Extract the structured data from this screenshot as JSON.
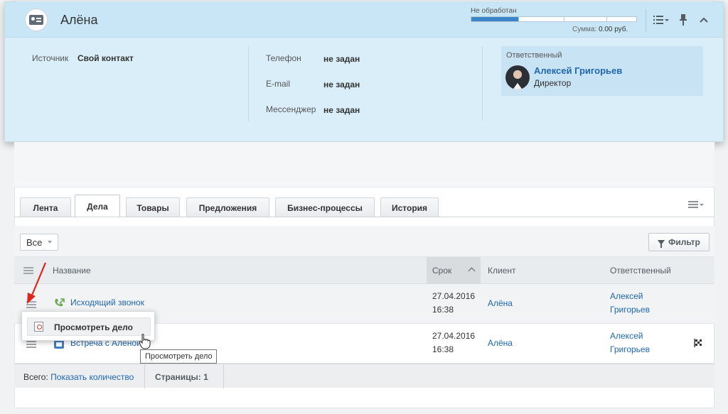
{
  "entity": {
    "name": "Алёна",
    "status": "Не обработан",
    "progress_fraction": 0.29,
    "sum_label": "Сумма:",
    "sum_value": "0.00 руб."
  },
  "details": {
    "source_label": "Источник",
    "source_value": "Свой контакт",
    "phone_label": "Телефон",
    "phone_value": "не задан",
    "email_label": "E-mail",
    "email_value": "не задан",
    "messenger_label": "Мессенджер",
    "messenger_value": "не задан"
  },
  "responsible": {
    "title": "Ответственный",
    "name": "Алексей Григорьев",
    "role": "Директор"
  },
  "tabs": [
    {
      "label": "Лента"
    },
    {
      "label": "Дела",
      "active": true
    },
    {
      "label": "Товары"
    },
    {
      "label": "Предложения"
    },
    {
      "label": "Бизнес-процессы"
    },
    {
      "label": "История"
    }
  ],
  "toolbar": {
    "select_value": "Все",
    "filter_label": "Фильтр"
  },
  "table": {
    "columns": [
      "Название",
      "Срок",
      "Клиент",
      "Ответственный"
    ],
    "rows": [
      {
        "title": "Исходящий звонок",
        "date": "27.04.2016",
        "time": "16:38",
        "client": "Алёна",
        "resp_first": "Алексей",
        "resp_last": "Григорьев",
        "icon": "phone-outgoing-icon"
      },
      {
        "title": "Встреча с Алёной",
        "date": "27.04.2016",
        "time": "16:38",
        "client": "Алёна",
        "resp_first": "Алексей",
        "resp_last": "Григорьев",
        "icon": "meeting-icon"
      }
    ]
  },
  "footer": {
    "total_label": "Всего:",
    "total_link": "Показать количество",
    "pages_label": "Страницы:",
    "pages_value": "1"
  },
  "popup": {
    "item_label": "Просмотреть дело"
  },
  "tooltip": {
    "text": "Просмотреть дело"
  },
  "colors": {
    "header_bg": "#d9eef9",
    "link": "#2067b0",
    "progress": "#3b86c8",
    "annotation_arrow": "#e0251b"
  }
}
